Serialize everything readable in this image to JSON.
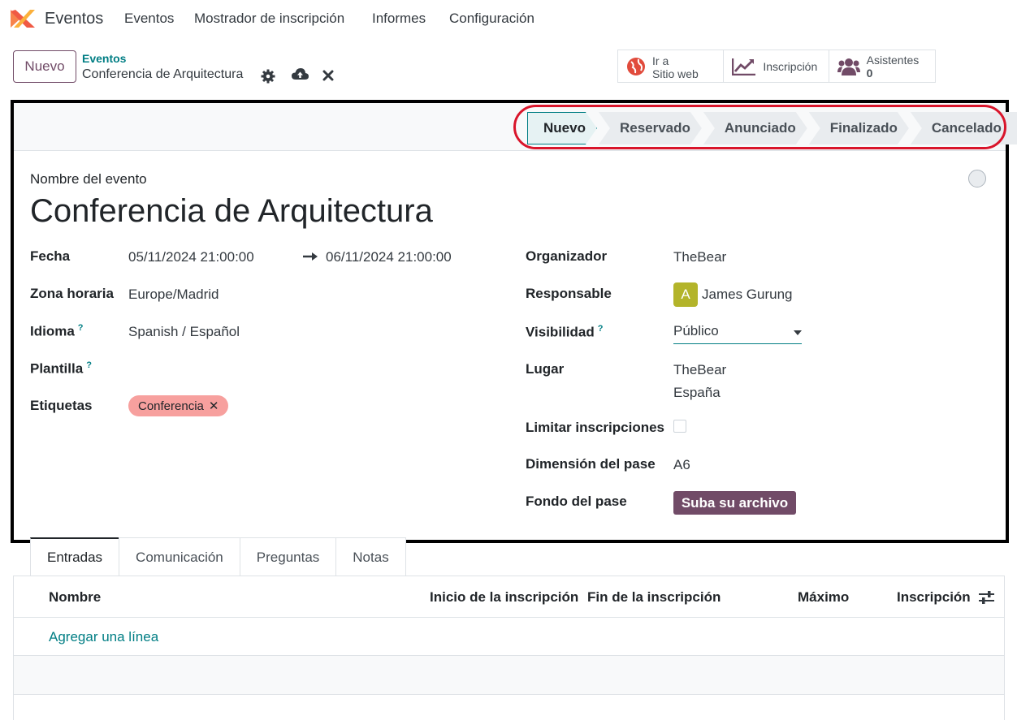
{
  "nav": {
    "app_name": "Eventos",
    "menu": [
      "Eventos",
      "Mostrador de inscripción",
      "Informes",
      "Configuración"
    ]
  },
  "control_panel": {
    "new_button": "Nuevo",
    "breadcrumb_parent": "Eventos",
    "breadcrumb_current": "Conferencia de Arquitectura",
    "smart_buttons": {
      "website": {
        "line1": "Ir a",
        "line2": "Sitio web"
      },
      "registration": {
        "label": "Inscripción"
      },
      "attendees": {
        "label": "Asistentes",
        "value": "0"
      }
    }
  },
  "statusbar": {
    "steps": [
      "Nuevo",
      "Reservado",
      "Anunciado",
      "Finalizado",
      "Cancelado"
    ],
    "active": "Nuevo"
  },
  "form": {
    "event_name_label": "Nombre del evento",
    "event_name": "Conferencia de Arquitectura",
    "left": {
      "date_label": "Fecha",
      "date_start": "05/11/2024 21:00:00",
      "date_end": "06/11/2024 21:00:00",
      "timezone_label": "Zona horaria",
      "timezone": "Europe/Madrid",
      "language_label": "Idioma",
      "language": "Spanish / Español",
      "template_label": "Plantilla",
      "tags_label": "Etiquetas",
      "tags": [
        "Conferencia"
      ],
      "help_mark": "?"
    },
    "right": {
      "organizer_label": "Organizador",
      "organizer": "TheBear",
      "responsible_label": "Responsable",
      "responsible_initial": "A",
      "responsible": "James Gurung",
      "visibility_label": "Visibilidad",
      "visibility": "Público",
      "venue_label": "Lugar",
      "venue_line1": "TheBear",
      "venue_line2": "España",
      "limit_label": "Limitar inscripciones",
      "limit_checked": false,
      "badge_size_label": "Dimensión del pase",
      "badge_size": "A6",
      "badge_bg_label": "Fondo del pase",
      "upload_label": "Suba su archivo"
    }
  },
  "notebook": {
    "tabs": [
      "Entradas",
      "Comunicación",
      "Preguntas",
      "Notas"
    ],
    "active_tab": "Entradas",
    "columns": [
      "Nombre",
      "Inicio de la inscripción",
      "Fin de la inscripción",
      "Máximo",
      "Inscripción"
    ],
    "add_line": "Agregar una línea"
  },
  "colors": {
    "brand": "#714b67",
    "accent": "#017e84",
    "highlight_outline": "#d9152b",
    "tag": "#f7a09e",
    "avatar": "#b3b42a"
  }
}
